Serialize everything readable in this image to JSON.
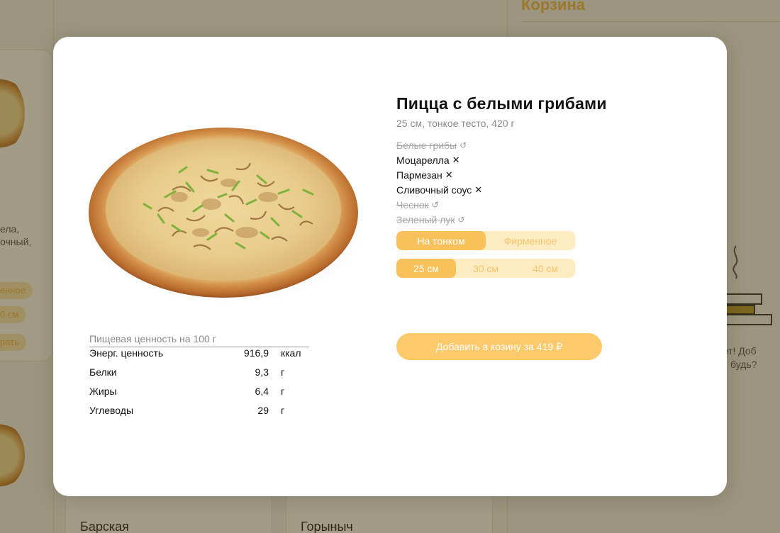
{
  "background": {
    "cart_title": "Корзина",
    "tile_titles": [
      "Барская",
      "Горыныч"
    ],
    "left_text_fragments": [
      "ела,",
      "очный,"
    ],
    "left_pills": [
      "енное",
      "0 см",
      "рать"
    ],
    "right_text_fragments": [
      "нет! Доб",
      "будь?"
    ]
  },
  "modal": {
    "name": "Пицца с белыми грибами",
    "subtitle": "25 см, тонкое тесто, 420 г",
    "ingredients": [
      {
        "label": "Белые грибы",
        "removed": true,
        "icon": "restore-icon",
        "glyph": "↺"
      },
      {
        "label": "Моцарелла",
        "removed": false,
        "icon": "remove-icon",
        "glyph": "✕"
      },
      {
        "label": "Пармезан",
        "removed": false,
        "icon": "remove-icon",
        "glyph": "✕"
      },
      {
        "label": "Сливочный соус",
        "removed": false,
        "icon": "remove-icon",
        "glyph": "✕"
      },
      {
        "label": "Чеснок",
        "removed": true,
        "icon": "restore-icon",
        "glyph": "↺"
      },
      {
        "label": "Зеленый лук",
        "removed": true,
        "icon": "restore-icon",
        "glyph": "↺"
      }
    ],
    "dough_options": [
      {
        "label": "На тонком",
        "active": true
      },
      {
        "label": "Фирменное",
        "active": false
      }
    ],
    "size_options": [
      {
        "label": "25 см",
        "active": true
      },
      {
        "label": "30 см",
        "active": false
      },
      {
        "label": "40 см",
        "active": false
      }
    ],
    "add_button": "Добавить в козину за 419 ₽",
    "nutrition": {
      "title": "Пищевая ценность на 100 г",
      "rows": [
        {
          "label": "Энерг. ценность",
          "value": "916,9",
          "unit": "ккал"
        },
        {
          "label": "Белки",
          "value": "9,3",
          "unit": "г"
        },
        {
          "label": "Жиры",
          "value": "6,4",
          "unit": "г"
        },
        {
          "label": "Углеводы",
          "value": "29",
          "unit": "г"
        }
      ]
    }
  },
  "colors": {
    "accent": "#f9c15a",
    "accent_light": "#fdebc2",
    "overlay": "#a2987a"
  }
}
